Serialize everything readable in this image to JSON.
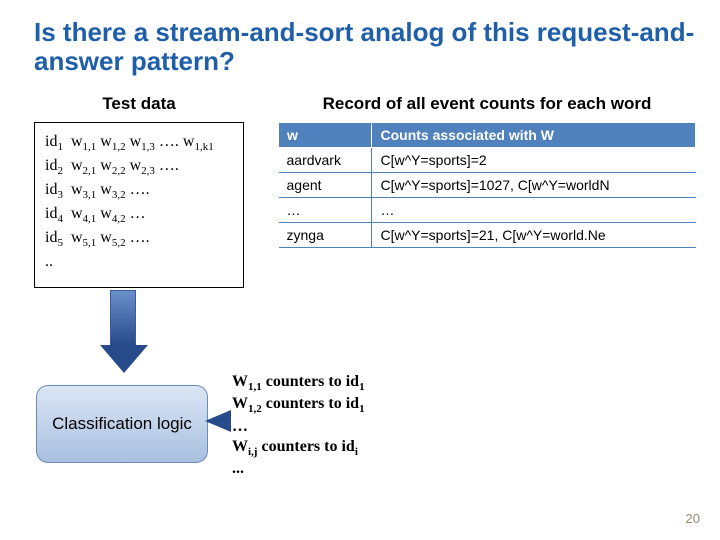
{
  "title": "Is there a stream-and-sort analog of this request-and-answer pattern?",
  "left": {
    "heading": "Test data",
    "rows_html": [
      "id<sub>1</sub>&nbsp;&nbsp;w<sub>1,1</sub> w<sub>1,2</sub> w<sub>1,3</sub> …. w<sub>1,k1</sub>",
      "id<sub>2</sub>&nbsp;&nbsp;w<sub>2,1</sub> w<sub>2,2</sub> w<sub>2,3</sub> ….",
      "id<sub>3</sub>&nbsp;&nbsp;w<sub>3,1</sub> w<sub>3,2</sub> ….",
      "id<sub>4</sub>&nbsp;&nbsp;w<sub>4,1</sub> w<sub>4,2</sub> …",
      "id<sub>5</sub>&nbsp;&nbsp;w<sub>5,1</sub> w<sub>5,2</sub> ….",
      ".."
    ]
  },
  "right": {
    "heading": "Record of all event counts for each word",
    "headers": [
      "w",
      "Counts associated with W"
    ],
    "rows": [
      [
        "aardvark",
        "C[w^Y=sports]=2"
      ],
      [
        "agent",
        "C[w^Y=sports]=1027, C[w^Y=worldN"
      ],
      [
        "…",
        "…"
      ],
      [
        "zynga",
        "C[w^Y=sports]=21, C[w^Y=world.Ne"
      ]
    ]
  },
  "classification": "Classification logic",
  "counters_html": [
    "W<sub>1,1</sub> counters to id<sub>1</sub>",
    "W<sub>1,2</sub> counters to id<sub>1</sub>",
    "…",
    "W<sub>i,j</sub> counters to id<sub>i</sub>",
    "..."
  ],
  "page_number": "20"
}
